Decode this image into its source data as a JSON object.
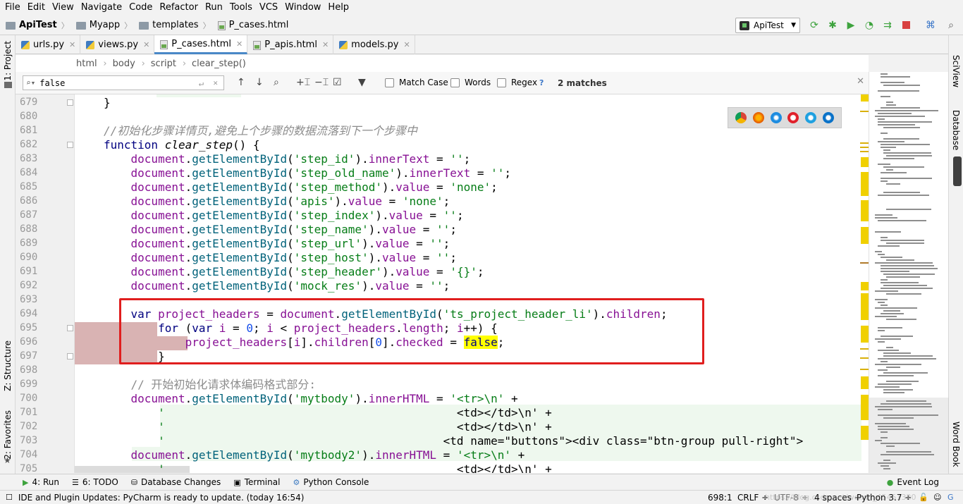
{
  "menu": [
    "File",
    "Edit",
    "View",
    "Navigate",
    "Code",
    "Refactor",
    "Run",
    "Tools",
    "VCS",
    "Window",
    "Help"
  ],
  "nav": {
    "project": "ApiTest",
    "folder1": "Myapp",
    "folder2": "templates",
    "file": "P_cases.html",
    "run_config": "ApiTest"
  },
  "left_tools": {
    "project": "1: Project",
    "structure": "Z: Structure",
    "favorites": "2: Favorites"
  },
  "right_tools": {
    "sciview": "SciView",
    "database": "Database",
    "wordbook": "Word Book"
  },
  "tabs": [
    {
      "label": "urls.py",
      "icon": "python-file-icon"
    },
    {
      "label": "views.py",
      "icon": "python-file-icon"
    },
    {
      "label": "P_cases.html",
      "icon": "html-file-icon",
      "active": true
    },
    {
      "label": "P_apis.html",
      "icon": "html-file-icon"
    },
    {
      "label": "models.py",
      "icon": "python-file-icon"
    }
  ],
  "breadcrumbs": [
    "html",
    "body",
    "script",
    "clear_step()"
  ],
  "find": {
    "query": "false",
    "match_case": "Match Case",
    "words": "Words",
    "regex": "Regex",
    "regex_help": "?",
    "matches": "2 matches"
  },
  "line_numbers": [
    "679",
    "680",
    "681",
    "682",
    "683",
    "684",
    "685",
    "686",
    "687",
    "688",
    "689",
    "690",
    "691",
    "692",
    "693",
    "694",
    "695",
    "696",
    "697",
    "698",
    "699",
    "700",
    "701",
    "702",
    "703",
    "704",
    "705"
  ],
  "code": {
    "l679": "}",
    "l681": "//初始化步骤详情页,避免上个步骤的数据流落到下一个步骤中",
    "l682_kw": "function",
    "l682_name": "clear_step",
    "l682_rest": "() {",
    "doc": "document",
    "gebi": "getElementById",
    "l683": [
      "'step_id'",
      "innerText",
      "''"
    ],
    "l684": [
      "'step_old_name'",
      "innerText",
      "''"
    ],
    "l685": [
      "'step_method'",
      "value",
      "'none'"
    ],
    "l686": [
      "'apis'",
      "value",
      "'none'"
    ],
    "l687": [
      "'step_index'",
      "value",
      "''"
    ],
    "l688": [
      "'step_name'",
      "value",
      "''"
    ],
    "l689": [
      "'step_url'",
      "value",
      "''"
    ],
    "l690": [
      "'step_host'",
      "value",
      "''"
    ],
    "l691": [
      "'step_header'",
      "value",
      "'{}'"
    ],
    "l692": [
      "'mock_res'",
      "value",
      "''"
    ],
    "l694_var": "var",
    "l694_name": "project_headers",
    "l694_arg": "'ts_project_header_li'",
    "l694_prop": "children",
    "l695_for": "for",
    "l695_var": "var",
    "l695_i": "i",
    "l695_zero": "0",
    "l695_name": "project_headers",
    "l695_len": "length",
    "l696_name": "project_headers",
    "l696_children": "children",
    "l696_idx": "0",
    "l696_checked": "checked",
    "l696_false": "false",
    "l697": "}",
    "l699": "// 开始初始化请求体编码格式部分:",
    "l700_arg": "'mytbody'",
    "l700_prop": "innerHTML",
    "l700_str": "'<tr>\\n'",
    "l701_str": "<td></td>\\n'",
    "l702_str": "<td></td>\\n'",
    "l703_str": "<td name=\"buttons\"><div class=\"btn-group pull-right\">",
    "l704_arg": "'mytbody2'",
    "l704_prop": "innerHTML",
    "l704_str": "'<tr>\\n'",
    "l705_str": "<td></td>\\n'"
  },
  "bottom_tools": [
    {
      "label": "4: Run"
    },
    {
      "label": "6: TODO"
    },
    {
      "label": "Database Changes"
    },
    {
      "label": "Terminal"
    },
    {
      "label": "Python Console"
    }
  ],
  "event_log": "Event Log",
  "status": {
    "message": "IDE and Plugin Updates: PyCharm is ready to update. (today 16:54)",
    "position": "698:1",
    "line_sep": "CRLF ÷",
    "encoding": "UTF-8 ÷",
    "indent": "4 spaces ÷",
    "interpreter": "Python 3.7 ÷",
    "watermark": "https://blog.csdn.net/weixin_45451320"
  },
  "colors": {
    "highlight_box": "#e01e1e",
    "match_highlight": "#ffff00",
    "keyword": "#000080",
    "string": "#067d17",
    "property": "#871094"
  }
}
